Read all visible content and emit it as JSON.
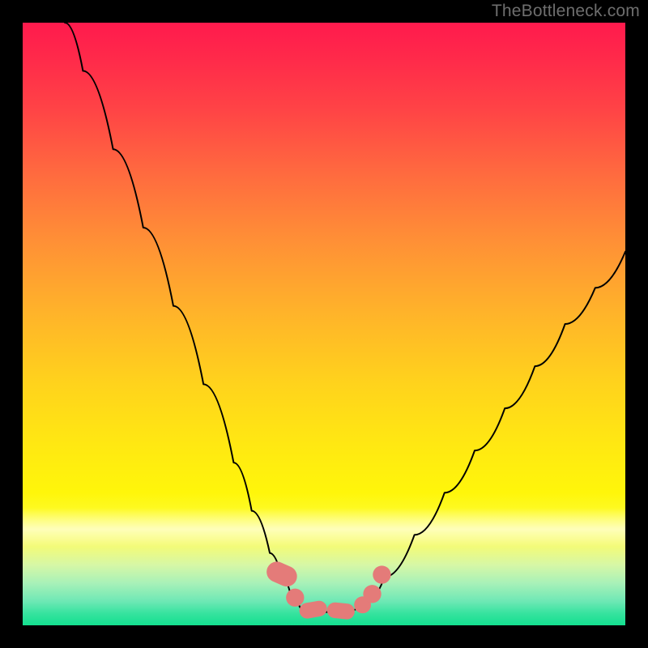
{
  "watermark": {
    "text": "TheBottleneck.com"
  },
  "colors": {
    "background_black": "#000000",
    "curve_stroke": "#000000",
    "marker_fill": "#e47b79",
    "gradient_top": "#ff1a4d",
    "gradient_mid": "#ffd31c",
    "gradient_bottom": "#13df8f",
    "watermark_text": "#6e6e6e"
  },
  "chart_data": {
    "type": "line",
    "title": "",
    "xlabel": "",
    "ylabel": "",
    "xlim": [
      0,
      100
    ],
    "ylim": [
      0,
      100
    ],
    "grid": false,
    "legend": null,
    "annotations": [],
    "series": [
      {
        "name": "left-curve",
        "x": [
          7,
          10,
          15,
          20,
          25,
          30,
          35,
          38,
          41,
          43,
          44.5,
          46
        ],
        "y": [
          100,
          92,
          79,
          66,
          53,
          40,
          27,
          19,
          12,
          8,
          5,
          3
        ]
      },
      {
        "name": "valley-floor",
        "x": [
          46,
          48,
          50,
          52,
          54,
          56
        ],
        "y": [
          3,
          2.4,
          2.2,
          2.2,
          2.4,
          3
        ]
      },
      {
        "name": "right-curve",
        "x": [
          56,
          58,
          60,
          65,
          70,
          75,
          80,
          85,
          90,
          95,
          100
        ],
        "y": [
          3,
          5,
          8,
          15,
          22,
          29,
          36,
          43,
          50,
          56,
          62
        ]
      }
    ],
    "markers": [
      {
        "shape": "round-rect",
        "cx": 43.0,
        "cy": 8.5,
        "w": 3.4,
        "h": 5.2,
        "rot": -66
      },
      {
        "shape": "circle",
        "cx": 45.2,
        "cy": 4.6,
        "r": 1.5
      },
      {
        "shape": "round-rect",
        "cx": 48.2,
        "cy": 2.6,
        "w": 4.6,
        "h": 2.6,
        "rot": -10
      },
      {
        "shape": "round-rect",
        "cx": 52.8,
        "cy": 2.4,
        "w": 4.6,
        "h": 2.6,
        "rot": 6
      },
      {
        "shape": "circle",
        "cx": 56.4,
        "cy": 3.4,
        "r": 1.4
      },
      {
        "shape": "circle",
        "cx": 58.0,
        "cy": 5.2,
        "r": 1.5
      },
      {
        "shape": "circle",
        "cx": 59.6,
        "cy": 8.4,
        "r": 1.5
      }
    ],
    "background_gradient_stops": [
      {
        "pos": 0.0,
        "color": "#ff1a4d"
      },
      {
        "pos": 0.25,
        "color": "#ff6a3f"
      },
      {
        "pos": 0.5,
        "color": "#ffb32a"
      },
      {
        "pos": 0.78,
        "color": "#fff60a"
      },
      {
        "pos": 0.93,
        "color": "#a8f1b8"
      },
      {
        "pos": 1.0,
        "color": "#13df8f"
      }
    ]
  }
}
